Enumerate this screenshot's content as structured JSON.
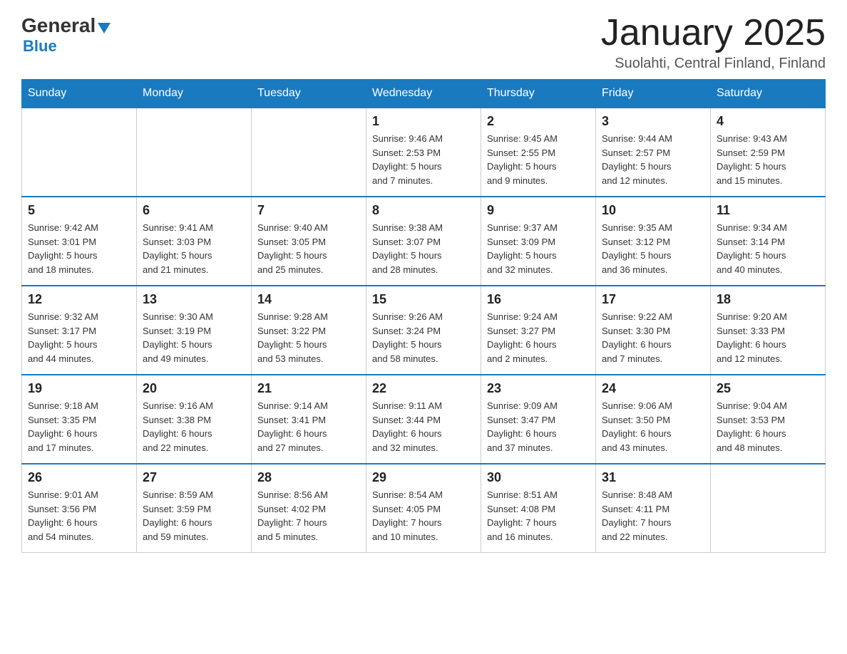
{
  "header": {
    "logo": {
      "general": "General",
      "blue": "Blue"
    },
    "title": "January 2025",
    "location": "Suolahti, Central Finland, Finland"
  },
  "weekdays": [
    "Sunday",
    "Monday",
    "Tuesday",
    "Wednesday",
    "Thursday",
    "Friday",
    "Saturday"
  ],
  "weeks": [
    [
      {
        "day": "",
        "info": ""
      },
      {
        "day": "",
        "info": ""
      },
      {
        "day": "",
        "info": ""
      },
      {
        "day": "1",
        "info": "Sunrise: 9:46 AM\nSunset: 2:53 PM\nDaylight: 5 hours\nand 7 minutes."
      },
      {
        "day": "2",
        "info": "Sunrise: 9:45 AM\nSunset: 2:55 PM\nDaylight: 5 hours\nand 9 minutes."
      },
      {
        "day": "3",
        "info": "Sunrise: 9:44 AM\nSunset: 2:57 PM\nDaylight: 5 hours\nand 12 minutes."
      },
      {
        "day": "4",
        "info": "Sunrise: 9:43 AM\nSunset: 2:59 PM\nDaylight: 5 hours\nand 15 minutes."
      }
    ],
    [
      {
        "day": "5",
        "info": "Sunrise: 9:42 AM\nSunset: 3:01 PM\nDaylight: 5 hours\nand 18 minutes."
      },
      {
        "day": "6",
        "info": "Sunrise: 9:41 AM\nSunset: 3:03 PM\nDaylight: 5 hours\nand 21 minutes."
      },
      {
        "day": "7",
        "info": "Sunrise: 9:40 AM\nSunset: 3:05 PM\nDaylight: 5 hours\nand 25 minutes."
      },
      {
        "day": "8",
        "info": "Sunrise: 9:38 AM\nSunset: 3:07 PM\nDaylight: 5 hours\nand 28 minutes."
      },
      {
        "day": "9",
        "info": "Sunrise: 9:37 AM\nSunset: 3:09 PM\nDaylight: 5 hours\nand 32 minutes."
      },
      {
        "day": "10",
        "info": "Sunrise: 9:35 AM\nSunset: 3:12 PM\nDaylight: 5 hours\nand 36 minutes."
      },
      {
        "day": "11",
        "info": "Sunrise: 9:34 AM\nSunset: 3:14 PM\nDaylight: 5 hours\nand 40 minutes."
      }
    ],
    [
      {
        "day": "12",
        "info": "Sunrise: 9:32 AM\nSunset: 3:17 PM\nDaylight: 5 hours\nand 44 minutes."
      },
      {
        "day": "13",
        "info": "Sunrise: 9:30 AM\nSunset: 3:19 PM\nDaylight: 5 hours\nand 49 minutes."
      },
      {
        "day": "14",
        "info": "Sunrise: 9:28 AM\nSunset: 3:22 PM\nDaylight: 5 hours\nand 53 minutes."
      },
      {
        "day": "15",
        "info": "Sunrise: 9:26 AM\nSunset: 3:24 PM\nDaylight: 5 hours\nand 58 minutes."
      },
      {
        "day": "16",
        "info": "Sunrise: 9:24 AM\nSunset: 3:27 PM\nDaylight: 6 hours\nand 2 minutes."
      },
      {
        "day": "17",
        "info": "Sunrise: 9:22 AM\nSunset: 3:30 PM\nDaylight: 6 hours\nand 7 minutes."
      },
      {
        "day": "18",
        "info": "Sunrise: 9:20 AM\nSunset: 3:33 PM\nDaylight: 6 hours\nand 12 minutes."
      }
    ],
    [
      {
        "day": "19",
        "info": "Sunrise: 9:18 AM\nSunset: 3:35 PM\nDaylight: 6 hours\nand 17 minutes."
      },
      {
        "day": "20",
        "info": "Sunrise: 9:16 AM\nSunset: 3:38 PM\nDaylight: 6 hours\nand 22 minutes."
      },
      {
        "day": "21",
        "info": "Sunrise: 9:14 AM\nSunset: 3:41 PM\nDaylight: 6 hours\nand 27 minutes."
      },
      {
        "day": "22",
        "info": "Sunrise: 9:11 AM\nSunset: 3:44 PM\nDaylight: 6 hours\nand 32 minutes."
      },
      {
        "day": "23",
        "info": "Sunrise: 9:09 AM\nSunset: 3:47 PM\nDaylight: 6 hours\nand 37 minutes."
      },
      {
        "day": "24",
        "info": "Sunrise: 9:06 AM\nSunset: 3:50 PM\nDaylight: 6 hours\nand 43 minutes."
      },
      {
        "day": "25",
        "info": "Sunrise: 9:04 AM\nSunset: 3:53 PM\nDaylight: 6 hours\nand 48 minutes."
      }
    ],
    [
      {
        "day": "26",
        "info": "Sunrise: 9:01 AM\nSunset: 3:56 PM\nDaylight: 6 hours\nand 54 minutes."
      },
      {
        "day": "27",
        "info": "Sunrise: 8:59 AM\nSunset: 3:59 PM\nDaylight: 6 hours\nand 59 minutes."
      },
      {
        "day": "28",
        "info": "Sunrise: 8:56 AM\nSunset: 4:02 PM\nDaylight: 7 hours\nand 5 minutes."
      },
      {
        "day": "29",
        "info": "Sunrise: 8:54 AM\nSunset: 4:05 PM\nDaylight: 7 hours\nand 10 minutes."
      },
      {
        "day": "30",
        "info": "Sunrise: 8:51 AM\nSunset: 4:08 PM\nDaylight: 7 hours\nand 16 minutes."
      },
      {
        "day": "31",
        "info": "Sunrise: 8:48 AM\nSunset: 4:11 PM\nDaylight: 7 hours\nand 22 minutes."
      },
      {
        "day": "",
        "info": ""
      }
    ]
  ]
}
